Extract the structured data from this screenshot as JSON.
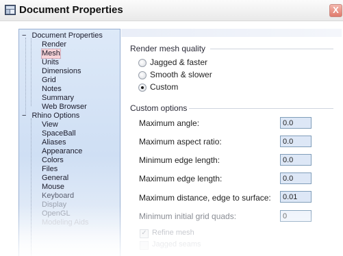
{
  "window": {
    "title": "Document Properties",
    "close_label": "X",
    "accent": "#97afd3",
    "close_color": "#e07a6c"
  },
  "tree": {
    "group1": {
      "label": "Document Properties",
      "expander": "−",
      "children": [
        "Render",
        "Mesh",
        "Units",
        "Dimensions",
        "Grid",
        "Notes",
        "Summary",
        "Web Browser"
      ]
    },
    "group2": {
      "label": "Rhino Options",
      "expander": "−",
      "children": [
        "View",
        "SpaceBall",
        "Aliases",
        "Appearance",
        "Colors",
        "Files",
        "General",
        "Mouse",
        "Keyboard",
        "Display",
        "OpenGL",
        "Modeling Aids"
      ]
    },
    "selected": "Mesh"
  },
  "render_quality": {
    "title": "Render mesh quality",
    "options": [
      "Jagged & faster",
      "Smooth & slower",
      "Custom"
    ],
    "selected": "Custom"
  },
  "custom_options": {
    "title": "Custom options",
    "fields": [
      {
        "label": "Maximum angle:",
        "value": "0.0"
      },
      {
        "label": "Maximum aspect ratio:",
        "value": "0.0"
      },
      {
        "label": "Minimum edge length:",
        "value": "0.0"
      },
      {
        "label": "Maximum edge length:",
        "value": "0.0"
      },
      {
        "label": "Maximum distance, edge to surface:",
        "value": "0.01"
      },
      {
        "label": "Minimum initial grid quads:",
        "value": "0"
      }
    ],
    "checkboxes": [
      {
        "label": "Refine mesh",
        "checked": true
      },
      {
        "label": "Jagged seams",
        "checked": false
      }
    ]
  },
  "icons": {
    "app": "rhino-document-icon",
    "close": "close-icon",
    "radio": "radio-button",
    "checkbox": "checkbox"
  }
}
